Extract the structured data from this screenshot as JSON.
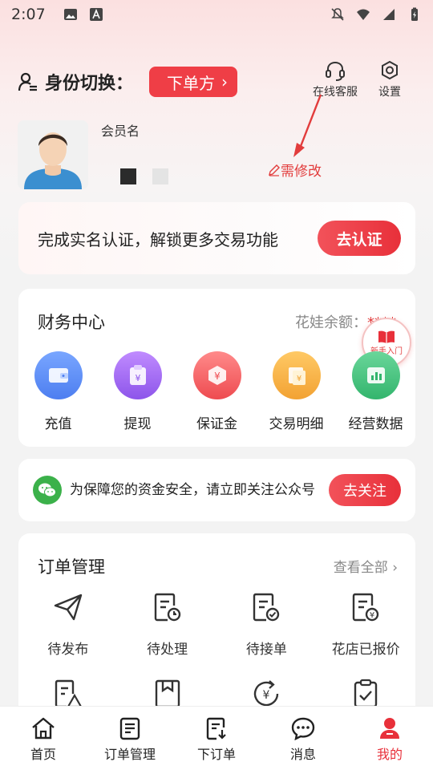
{
  "status_bar": {
    "time": "2:07"
  },
  "identity": {
    "title": "身份切换：",
    "role_button": "下单方",
    "chevron": "›"
  },
  "top_actions": {
    "customer_service": "在线客服",
    "settings": "设置"
  },
  "profile": {
    "member_name": "会员名",
    "edit_label": "需修改"
  },
  "verify": {
    "text": "完成实名认证，解锁更多交易功能",
    "button": "去认证"
  },
  "finance": {
    "title": "财务中心",
    "balance_label": "花娃余额：",
    "balance_value": "****",
    "newbie_badge": "新手入门",
    "items": [
      {
        "label": "充值",
        "icon": "wallet-icon",
        "color": "#5b8ff5"
      },
      {
        "label": "提现",
        "icon": "withdraw-icon",
        "color": "#a46cf0"
      },
      {
        "label": "保证金",
        "icon": "deposit-icon",
        "color": "#f26468"
      },
      {
        "label": "交易明细",
        "icon": "receipt-icon",
        "color": "#f6b041"
      },
      {
        "label": "经营数据",
        "icon": "chart-icon",
        "color": "#3fbf7a"
      }
    ]
  },
  "wechat": {
    "text": "为保障您的资金安全，请立即关注公众号",
    "button": "去关注"
  },
  "orders": {
    "title": "订单管理",
    "view_all": "查看全部 ›",
    "items": [
      {
        "label": "待发布",
        "icon": "send-icon"
      },
      {
        "label": "待处理",
        "icon": "pending-icon"
      },
      {
        "label": "待接单",
        "icon": "accept-icon"
      },
      {
        "label": "花店已报价",
        "icon": "quote-icon"
      }
    ]
  },
  "bottom_nav": [
    {
      "label": "首页",
      "icon": "home-icon"
    },
    {
      "label": "订单管理",
      "icon": "order-list-icon"
    },
    {
      "label": "下订单",
      "icon": "place-order-icon"
    },
    {
      "label": "消息",
      "icon": "message-icon"
    },
    {
      "label": "我的",
      "icon": "profile-icon",
      "active": true
    }
  ],
  "colors": {
    "accent": "#ef3e46",
    "background": "#f3f3f3"
  }
}
